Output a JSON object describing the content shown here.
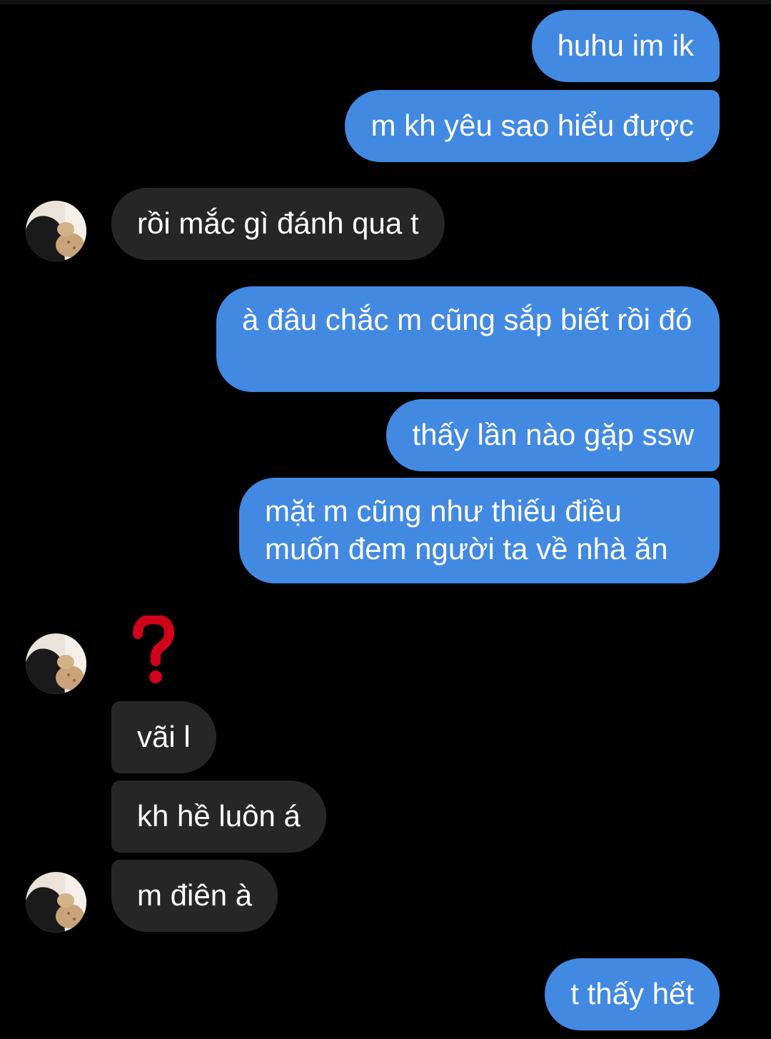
{
  "colors": {
    "background": "#000000",
    "outgoing_bubble": "#4289e2",
    "incoming_bubble": "#262626",
    "text": "#ffffff",
    "reaction": "#d0021b"
  },
  "messages": [
    {
      "direction": "outgoing",
      "text": "huhu im ik"
    },
    {
      "direction": "outgoing",
      "text": "m kh yêu sao hiểu được"
    },
    {
      "direction": "incoming",
      "text": "rồi mắc gì đánh qua t"
    },
    {
      "direction": "outgoing",
      "text": "à đâu chắc m cũng sắp biết rồi đó"
    },
    {
      "direction": "outgoing",
      "text": "thấy lần nào gặp ssw"
    },
    {
      "direction": "outgoing",
      "text": "mặt m cũng như thiếu điều muốn đem người ta về nhà ăn"
    },
    {
      "direction": "incoming",
      "text": "vãi l"
    },
    {
      "direction": "incoming",
      "text": "kh hề luôn á"
    },
    {
      "direction": "incoming",
      "text": "m điên à"
    },
    {
      "direction": "outgoing",
      "text": "t thấy hết"
    }
  ],
  "reaction": {
    "icon": "red-question-mark-icon"
  }
}
